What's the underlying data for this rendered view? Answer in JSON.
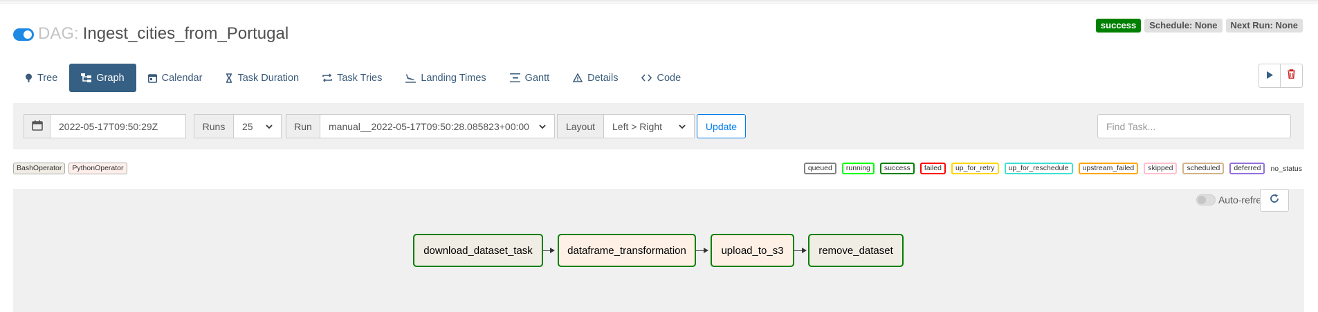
{
  "header": {
    "dag_prefix": "DAG:",
    "dag_id": "Ingest_cities_from_Portugal",
    "toggle_on": true
  },
  "badges": {
    "state": "success",
    "schedule": "Schedule: None",
    "next_run": "Next Run: None"
  },
  "tabs": [
    {
      "label": "Tree",
      "icon": "tree-icon",
      "active": false
    },
    {
      "label": "Graph",
      "icon": "graph-icon",
      "active": true
    },
    {
      "label": "Calendar",
      "icon": "calendar-icon",
      "active": false
    },
    {
      "label": "Task Duration",
      "icon": "hourglass-icon",
      "active": false
    },
    {
      "label": "Task Tries",
      "icon": "repeat-icon",
      "active": false
    },
    {
      "label": "Landing Times",
      "icon": "plane-landing-icon",
      "active": false
    },
    {
      "label": "Gantt",
      "icon": "gantt-icon",
      "active": false
    },
    {
      "label": "Details",
      "icon": "warning-triangle-icon",
      "active": false
    },
    {
      "label": "Code",
      "icon": "code-icon",
      "active": false
    }
  ],
  "actions": {
    "trigger_icon": "play-icon",
    "delete_icon": "trash-icon"
  },
  "controls": {
    "base_date": "2022-05-17T09:50:29Z",
    "runs_label": "Runs",
    "runs_value": "25",
    "run_label": "Run",
    "run_value": "manual__2022-05-17T09:50:28.085823+00:00",
    "layout_label": "Layout",
    "layout_value": "Left > Right",
    "update_label": "Update",
    "find_placeholder": "Find Task..."
  },
  "operators": [
    {
      "label": "BashOperator",
      "color": "#f0ede4"
    },
    {
      "label": "PythonOperator",
      "color": "#ffefeb"
    }
  ],
  "states": [
    {
      "label": "queued",
      "color": "#808080"
    },
    {
      "label": "running",
      "color": "#00ff00"
    },
    {
      "label": "success",
      "color": "#008000"
    },
    {
      "label": "failed",
      "color": "#ff0000"
    },
    {
      "label": "up_for_retry",
      "color": "#ffd700"
    },
    {
      "label": "up_for_reschedule",
      "color": "#40e0d0"
    },
    {
      "label": "upstream_failed",
      "color": "#ffa500"
    },
    {
      "label": "skipped",
      "color": "#ffc0cb"
    },
    {
      "label": "scheduled",
      "color": "#d2b48c"
    },
    {
      "label": "deferred",
      "color": "#9370db"
    },
    {
      "label": "no_status",
      "color": null
    }
  ],
  "graph": {
    "auto_refresh_label": "Auto-refresh",
    "auto_refresh_on": false,
    "nodes": [
      {
        "label": "download_dataset_task",
        "operator": "BashOperator",
        "state": "success"
      },
      {
        "label": "dataframe_transformation",
        "operator": "PythonOperator",
        "state": "success"
      },
      {
        "label": "upload_to_s3",
        "operator": "PythonOperator",
        "state": "success"
      },
      {
        "label": "remove_dataset",
        "operator": "BashOperator",
        "state": "success"
      }
    ]
  }
}
